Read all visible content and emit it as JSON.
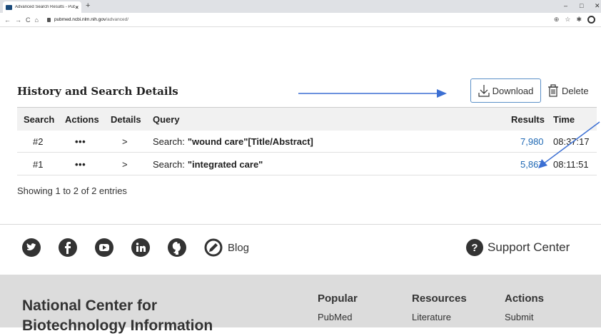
{
  "browser": {
    "tab_title": "Advanced Search Results - PubMe",
    "close": "×",
    "new_tab": "+",
    "nav": {
      "back": "←",
      "forward": "→",
      "reload": "C",
      "home": "⌂"
    },
    "url_host": "pubmed.ncbi.nlm.nih.gov",
    "url_path": "/advanced/",
    "win_min": "–",
    "win_max": "□",
    "win_close": "✕"
  },
  "history": {
    "title": "History and Search Details",
    "download_label": "Download",
    "delete_label": "Delete",
    "columns": [
      "Search",
      "Actions",
      "Details",
      "Query",
      "Results",
      "Time"
    ],
    "rows": [
      {
        "search": "#2",
        "actions": "•••",
        "details": ">",
        "query_prefix": "Search:",
        "query": "\"wound care\"[Title/Abstract]",
        "results": "7,980",
        "time": "08:37:17"
      },
      {
        "search": "#1",
        "actions": "•••",
        "details": ">",
        "query_prefix": "Search:",
        "query": "\"integrated care\"",
        "results": "5,867",
        "time": "08:11:51"
      }
    ],
    "showing": "Showing 1 to 2 of 2 entries"
  },
  "social": {
    "icons": [
      "twitter-icon",
      "facebook-icon",
      "youtube-icon",
      "linkedin-icon",
      "github-icon",
      "blog-icon"
    ],
    "blog_label": "Blog",
    "support_label": "Support Center"
  },
  "footer": {
    "org_line1": "National Center for",
    "org_line2": "Biotechnology Information",
    "columns": [
      {
        "heading": "Popular",
        "link": "PubMed"
      },
      {
        "heading": "Resources",
        "link": "Literature"
      },
      {
        "heading": "Actions",
        "link": "Submit"
      }
    ]
  },
  "colors": {
    "link": "#2069b4",
    "arrow": "#3b6fd3",
    "footer_bg": "#dcdcdc"
  }
}
